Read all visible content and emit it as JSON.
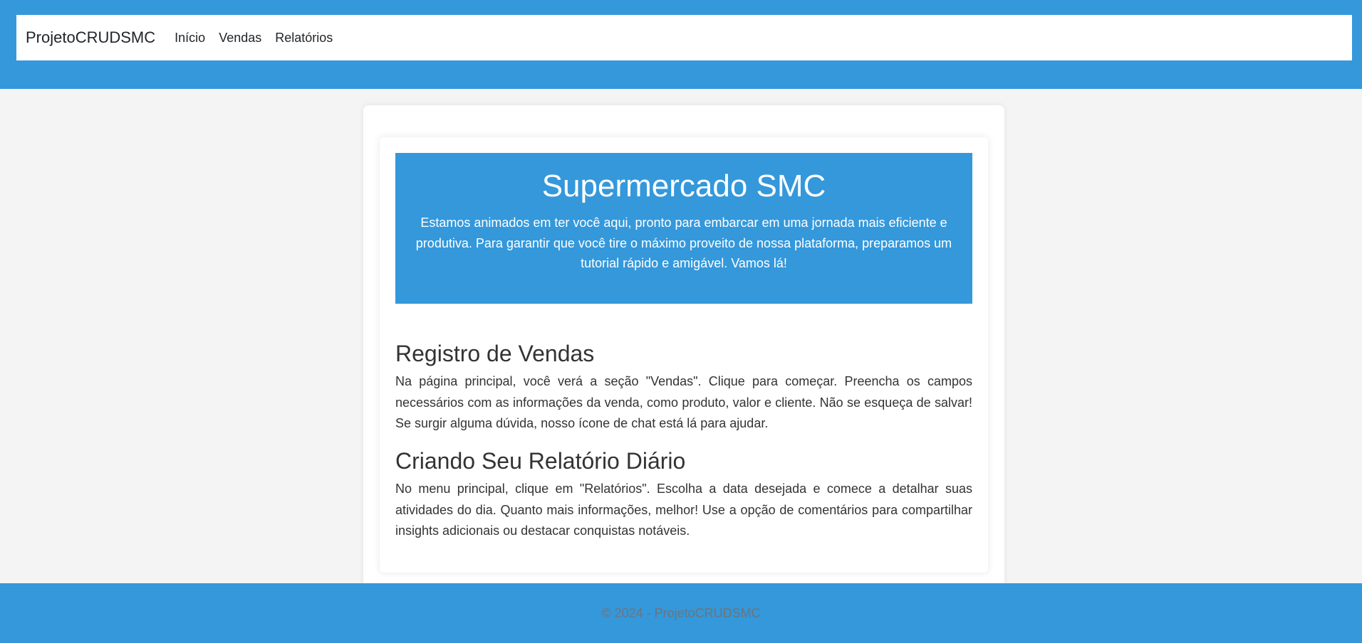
{
  "navbar": {
    "brand": "ProjetoCRUDSMC",
    "links": [
      "Início",
      "Vendas",
      "Relatórios"
    ]
  },
  "hero": {
    "title": "Supermercado SMC",
    "text": "Estamos animados em ter você aqui, pronto para embarcar em uma jornada mais eficiente e produtiva. Para garantir que você tire o máximo proveito de nossa plataforma, preparamos um tutorial rápido e amigável. Vamos lá!"
  },
  "sections": [
    {
      "heading": "Registro de Vendas",
      "text": "Na página principal, você verá a seção \"Vendas\". Clique para começar. Preencha os campos necessários com as informações da venda, como produto, valor e cliente. Não se esqueça de salvar! Se surgir alguma dúvida, nosso ícone de chat está lá para ajudar."
    },
    {
      "heading": "Criando Seu Relatório Diário",
      "text": "No menu principal, clique em \"Relatórios\". Escolha a data desejada e comece a detalhar suas atividades do dia. Quanto mais informações, melhor! Use a opção de comentários para compartilhar insights adicionais ou destacar conquistas notáveis."
    }
  ],
  "footer": {
    "text": "© 2024 - ProjetoCRUDSMC"
  },
  "colors": {
    "primary": "#3498db",
    "background": "#f4f4f4",
    "footer_text": "#6c757d"
  }
}
